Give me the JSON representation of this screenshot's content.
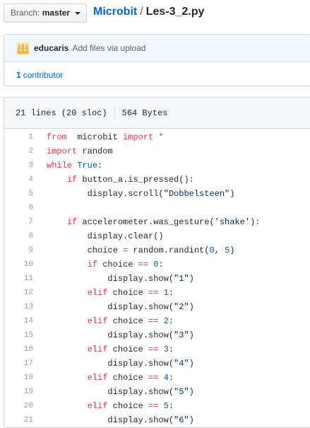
{
  "branch": {
    "label": "Branch:",
    "value": "master"
  },
  "breadcrumb": {
    "repo": "Microbit",
    "separator": "/",
    "file": "Les-3_2.py"
  },
  "commit": {
    "author": "educaris",
    "message": "Add files via upload"
  },
  "contributors": {
    "count": "1",
    "label": "contributor"
  },
  "file_info": {
    "lines": "21 lines (20 sloc)",
    "size": "564 Bytes"
  },
  "code_lines": [
    [
      [
        "kw",
        "from"
      ],
      [
        "",
        "  microbit "
      ],
      [
        "kw",
        "import"
      ],
      [
        "kw",
        " *"
      ]
    ],
    [
      [
        "kw",
        "import"
      ],
      [
        "",
        " random"
      ]
    ],
    [
      [
        "kw",
        "while"
      ],
      [
        "",
        " "
      ],
      [
        "bi",
        "True"
      ],
      [
        "",
        ":"
      ]
    ],
    [
      [
        "",
        "    "
      ],
      [
        "kw",
        "if"
      ],
      [
        "",
        " button_a.is_pressed():"
      ]
    ],
    [
      [
        "",
        "        display.scroll("
      ],
      [
        "str",
        "\"Dobbelsteen\""
      ],
      [
        "",
        ")"
      ]
    ],
    [],
    [
      [
        "",
        "    "
      ],
      [
        "kw",
        "if"
      ],
      [
        "",
        " accelerometer.was_gesture("
      ],
      [
        "str",
        "'shake'"
      ],
      [
        "",
        "):"
      ]
    ],
    [
      [
        "",
        "        display.clear()"
      ]
    ],
    [
      [
        "",
        "        choice "
      ],
      [
        "kw",
        "="
      ],
      [
        "",
        " random.randint("
      ],
      [
        "num",
        "0"
      ],
      [
        "",
        ", "
      ],
      [
        "num",
        "5"
      ],
      [
        "",
        ")"
      ]
    ],
    [
      [
        "",
        "        "
      ],
      [
        "kw",
        "if"
      ],
      [
        "",
        " choice "
      ],
      [
        "kw",
        "=="
      ],
      [
        " ",
        " "
      ],
      [
        "num",
        "0"
      ],
      [
        "",
        ":"
      ]
    ],
    [
      [
        "",
        "            display.show("
      ],
      [
        "str",
        "\"1\""
      ],
      [
        "",
        ")"
      ]
    ],
    [
      [
        "",
        "        "
      ],
      [
        "kw",
        "elif"
      ],
      [
        "",
        " choice "
      ],
      [
        "kw",
        "=="
      ],
      [
        "",
        " "
      ],
      [
        "num",
        "1"
      ],
      [
        "",
        ":"
      ]
    ],
    [
      [
        "",
        "            display.show("
      ],
      [
        "str",
        "\"2\""
      ],
      [
        "",
        ")"
      ]
    ],
    [
      [
        "",
        "        "
      ],
      [
        "kw",
        "elif"
      ],
      [
        "",
        " choice "
      ],
      [
        "kw",
        "=="
      ],
      [
        "",
        " "
      ],
      [
        "num",
        "2"
      ],
      [
        "",
        ":"
      ]
    ],
    [
      [
        "",
        "            display.show("
      ],
      [
        "str",
        "\"3\""
      ],
      [
        "",
        ")"
      ]
    ],
    [
      [
        "",
        "        "
      ],
      [
        "kw",
        "elif"
      ],
      [
        "",
        " choice "
      ],
      [
        "kw",
        "=="
      ],
      [
        "",
        " "
      ],
      [
        "num",
        "3"
      ],
      [
        "",
        ":"
      ]
    ],
    [
      [
        "",
        "            display.show("
      ],
      [
        "str",
        "\"4\""
      ],
      [
        "",
        ")"
      ]
    ],
    [
      [
        "",
        "        "
      ],
      [
        "kw",
        "elif"
      ],
      [
        "",
        " choice "
      ],
      [
        "kw",
        "=="
      ],
      [
        "",
        " "
      ],
      [
        "num",
        "4"
      ],
      [
        "",
        ":"
      ]
    ],
    [
      [
        "",
        "            display.show("
      ],
      [
        "str",
        "\"5\""
      ],
      [
        "",
        ")"
      ]
    ],
    [
      [
        "",
        "        "
      ],
      [
        "kw",
        "elif"
      ],
      [
        "",
        " choice "
      ],
      [
        "kw",
        "=="
      ],
      [
        "",
        " "
      ],
      [
        "num",
        "5"
      ],
      [
        "",
        ":"
      ]
    ],
    [
      [
        "",
        "            display.show("
      ],
      [
        "str",
        "\"6\""
      ],
      [
        "",
        ")"
      ]
    ]
  ],
  "colors": {
    "link": "#0366d6",
    "keyword": "#d73a49",
    "string": "#032f62",
    "constant": "#005cc5",
    "line_number": "#959da5"
  },
  "icons": {
    "avatar": "avatar-icon",
    "caret": "caret-down-icon"
  }
}
